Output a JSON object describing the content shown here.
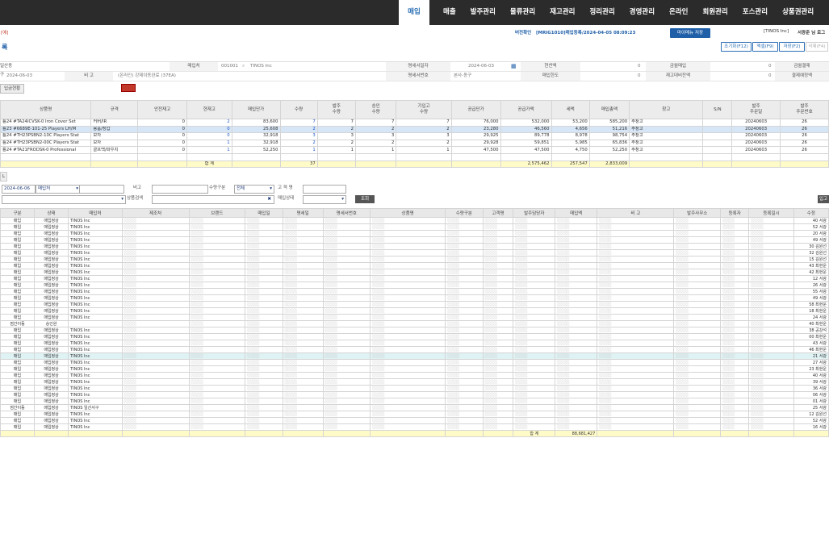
{
  "nav": {
    "menu": [
      "매입",
      "매출",
      "발주관리",
      "물류관리",
      "재고관리",
      "정리관리",
      "경영관리",
      "온라인",
      "회원관리",
      "포스관리",
      "상품권관리"
    ],
    "active": "매입"
  },
  "header": {
    "left_tag": "[예]",
    "version_label": "버전확인",
    "path": "[MRIG1010]매입등록/2024-04-05 08:09:23",
    "my_menu_btn": "마이메뉴 저장",
    "company": "[TINOS Inc]",
    "user": "서광준 님 로그",
    "buttons": [
      "조기화(F12)",
      "엑셀(F9)",
      "저장(F2)",
      "삭제(F4)"
    ]
  },
  "page_title": "록",
  "form": {
    "row1": {
      "store_label": "일산동구",
      "vendor_label": "매입처",
      "vendor_code": "001001",
      "vendor_name": "TINOS Inc",
      "issuer_label": "명세서일자",
      "issuer_date": "2024-06-03",
      "cash_label": "현찬액",
      "cash_val": "0",
      "amount_label": "금월매입",
      "amount_val": "0",
      "pay_label": "금월결제"
    },
    "row2": {
      "date": "2024-06-03",
      "memo_label": "비 고",
      "memo_val": "(온라인) 강제이동완료 (37EA)",
      "stmt_no_label": "명세서번호",
      "stmt_no_val": "본사-동구",
      "limit_label": "매입한도",
      "limit_val": "0",
      "stock_label": "재고대비잔액",
      "stock_val": "0",
      "bal_label": "결제예정액"
    }
  },
  "tab_label": "입금현황",
  "top_table": {
    "headers": [
      "상품명",
      "규격",
      "안전재고",
      "현재고",
      "매입단가",
      "수량",
      "발주\n수량",
      "승인\n수량",
      "기입고\n수량",
      "공급단가",
      "공급가액",
      "세액",
      "매입총액",
      "창고",
      "S/N",
      "발주\n주문일",
      "발주\n주문번호"
    ],
    "rows": [
      {
        "name": "틀24 #TA24ICVSK-0 Iron Cover Set",
        "spec": "커버/IR",
        "safe": "0",
        "stock": "2",
        "price": "83,600",
        "qty": "7",
        "po": "7",
        "ap": "7",
        "in": "7",
        "unit": "76,000",
        "supply": "532,000",
        "tax": "53,200",
        "total": "585,200",
        "wh": "주창고",
        "sn": "",
        "date": "20240603",
        "no": "26"
      },
      {
        "name": "틀23 #6689E-101-25 Players LH/M",
        "spec": "용품/장갑",
        "safe": "0",
        "stock": "0",
        "price": "25,608",
        "qty": "2",
        "po": "2",
        "ap": "2",
        "in": "2",
        "unit": "23,280",
        "supply": "46,560",
        "tax": "4,656",
        "total": "51,216",
        "wh": "주창고",
        "sn": "",
        "date": "20240603",
        "no": "26"
      },
      {
        "name": "틀24 #TH23PSBN2-10C Players Stat",
        "spec": "모자",
        "safe": "0",
        "stock": "0",
        "price": "32,918",
        "qty": "3",
        "po": "3",
        "ap": "3",
        "in": "3",
        "unit": "29,925",
        "supply": "89,778",
        "tax": "8,978",
        "total": "98,754",
        "wh": "주창고",
        "sn": "",
        "date": "20240603",
        "no": "26"
      },
      {
        "name": "틀24 #TH23PSBN2-00C Players Stat",
        "spec": "모자",
        "safe": "0",
        "stock": "1",
        "price": "32,918",
        "qty": "2",
        "po": "2",
        "ap": "2",
        "in": "2",
        "unit": "29,928",
        "supply": "59,851",
        "tax": "5,985",
        "total": "65,836",
        "wh": "주창고",
        "sn": "",
        "date": "20240603",
        "no": "26"
      },
      {
        "name": "틀24 #TA21FRODSK-0 Professional",
        "spec": "골프백/파우치",
        "safe": "0",
        "stock": "1",
        "price": "52,250",
        "qty": "1",
        "po": "1",
        "ap": "1",
        "in": "1",
        "unit": "47,500",
        "supply": "47,500",
        "tax": "4,750",
        "total": "52,250",
        "wh": "주창고",
        "sn": "",
        "date": "20240603",
        "no": "26"
      }
    ],
    "sum_label": "합 계",
    "sum_qty": "37",
    "sum_supply": "2,575,462",
    "sum_tax": "257,547",
    "sum_total": "2,833,009"
  },
  "filter": {
    "section_tab": "L",
    "date": "2024-06-06",
    "vendor_sel": "매입처",
    "memo_label": "비고",
    "qty_label": "수량구분",
    "qty_sel": "전체",
    "customer_label": "고 객 명",
    "search_label": "상품검색",
    "status_label": "매입상태",
    "search_btn": "조회",
    "right_btn": "입고"
  },
  "bottom_table": {
    "headers": [
      "구분",
      "상태",
      "매입처",
      "제조처",
      "브랜드",
      "매입일",
      "명세일",
      "명세서번호",
      "상품명",
      "수량구분",
      "고객명",
      "발주담당자",
      "매입액",
      "비 고",
      "발주사무소",
      "등록자",
      "등록일시",
      "수정"
    ],
    "rows": [
      [
        "매입",
        "매입정상",
        "TINOS Inc",
        "40 서광"
      ],
      [
        "매입",
        "매입정상",
        "TINOS Inc",
        "52 서광"
      ],
      [
        "매입",
        "매입정상",
        "TINOS Inc",
        "20 서광"
      ],
      [
        "매입",
        "매입정상",
        "TINOS Inc",
        "49 서광"
      ],
      [
        "매입",
        "매입정상",
        "TINOS Inc",
        "30 김원선"
      ],
      [
        "매입",
        "매입정상",
        "TINOS Inc",
        "32 김원선"
      ],
      [
        "매입",
        "매입정상",
        "TINOS Inc",
        "15 김원선"
      ],
      [
        "매입",
        "매입정상",
        "TINOS Inc",
        "43 최현운"
      ],
      [
        "매입",
        "매입정상",
        "TINOS Inc",
        "42 최현운"
      ],
      [
        "매입",
        "매입정상",
        "TINOS Inc",
        "12 서광"
      ],
      [
        "매입",
        "매입정상",
        "TINOS Inc",
        "26 서광"
      ],
      [
        "매입",
        "매입정상",
        "TINOS Inc",
        "55 서광"
      ],
      [
        "매입",
        "매입정상",
        "TINOS Inc",
        "49 서광"
      ],
      [
        "매입",
        "매입정상",
        "TINOS Inc",
        "58 최현운"
      ],
      [
        "매입",
        "매입정상",
        "TINOS Inc",
        "18 최현운"
      ],
      [
        "매입",
        "매입정상",
        "TINOS Inc",
        "24 서광"
      ],
      [
        "점간이동",
        "승인완",
        "",
        "40 최현운"
      ],
      [
        "매입",
        "매입정상",
        "TINOS Inc",
        "38 공강석"
      ],
      [
        "매입",
        "매입정상",
        "TINOS Inc",
        "00 최현운"
      ],
      [
        "매입",
        "매입정상",
        "TINOS Inc",
        "43 서광"
      ],
      [
        "매입",
        "매입정상",
        "TINOS Inc",
        "46 최현운"
      ],
      [
        "매입",
        "매입정상",
        "TINOS Inc",
        "21 서광"
      ],
      [
        "매입",
        "매입정상",
        "TINOS Inc",
        "27 서광"
      ],
      [
        "매입",
        "매입정상",
        "TINOS Inc",
        "23 최현운"
      ],
      [
        "매입",
        "매입정상",
        "TINOS Inc",
        "40 서광"
      ],
      [
        "매입",
        "매입정상",
        "TINOS Inc",
        "39 서광"
      ],
      [
        "매입",
        "매입정상",
        "TINOS Inc",
        "36 서광"
      ],
      [
        "매입",
        "매입정상",
        "TINOS Inc",
        "06 서광"
      ],
      [
        "매입",
        "매입정상",
        "TINOS Inc",
        "01 서광"
      ],
      [
        "점간이동",
        "매입정상",
        "TINOS 일산서구",
        "25 서광"
      ],
      [
        "매입",
        "매입정상",
        "TINOS Inc",
        "12 김원선"
      ],
      [
        "매입",
        "매입정상",
        "TINOS Inc",
        "52 서광"
      ],
      [
        "매입",
        "매입정상",
        "TINOS Inc",
        "16 서광"
      ]
    ],
    "highlight_index": 21,
    "sum_label": "합 계",
    "sum_total": "88,681,427"
  }
}
